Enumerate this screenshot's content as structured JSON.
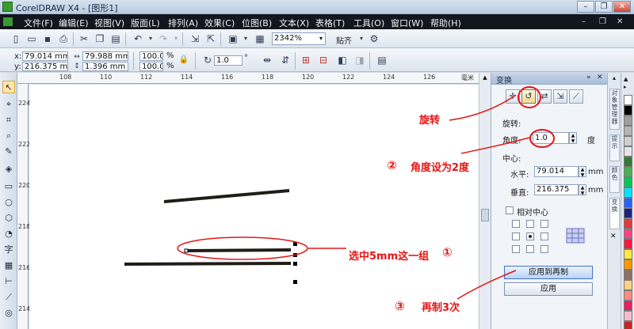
{
  "titlebar": {
    "title": "CorelDRAW X4 - [图形1]"
  },
  "menu": [
    "文件(F)",
    "编辑(E)",
    "视图(V)",
    "版面(L)",
    "排列(A)",
    "效果(C)",
    "位图(B)",
    "文本(X)",
    "表格(T)",
    "工具(O)",
    "窗口(W)",
    "帮助(H)"
  ],
  "standard_toolbar": {
    "zoom": "2342%",
    "snap": "贴齐"
  },
  "property_bar": {
    "x_label": "x:",
    "x": "79.014 mm",
    "y_label": "y:",
    "y": "216.375 mm",
    "w": "79.988 mm",
    "h": "1.396 mm",
    "scale_x": "100.0",
    "scale_y": "100.0",
    "pct": "%",
    "angle": "1.0",
    "deg": "°"
  },
  "rulers": {
    "h_ticks": [
      "108",
      "110",
      "112",
      "114",
      "116",
      "118",
      "120",
      "122",
      "124",
      "126"
    ],
    "h_unit": "毫米",
    "v_ticks": [
      "224",
      "222",
      "220",
      "218",
      "216",
      "214"
    ]
  },
  "docker": {
    "title": "变换",
    "section": "旋转:",
    "angle_label": "角度:",
    "angle_value": "1.0",
    "angle_unit": "度",
    "center_label": "中心:",
    "h_label": "水平:",
    "h_value": "79.014",
    "v_label": "垂直:",
    "v_value": "216.375",
    "unit": "mm",
    "relative_center": "相对中心",
    "apply_dup": "应用到再制",
    "apply": "应用"
  },
  "vertical_tabs": [
    "对象管理器",
    "提示",
    "颜色",
    "变换"
  ],
  "palette_colors": [
    "#ffffff",
    "#000000",
    "#9e9e9e",
    "#b5b5b5",
    "#cfcfcf",
    "#e6e6e6",
    "#2e7d32",
    "#4caf50",
    "#00c853",
    "#00e5ff",
    "#2962ff",
    "#1a237e",
    "#e53935",
    "#ff4081",
    "#ff1744",
    "#ffeb3b",
    "#ff9800",
    "#8d6e63",
    "#ffd180",
    "#ff8a80",
    "#e91e63",
    "#f8bbd0",
    "#c62828"
  ],
  "annotations": {
    "rotate": "旋转",
    "angle_step": "角度设为2度",
    "select": "选中5mm这一组",
    "dup": "再制3次"
  }
}
